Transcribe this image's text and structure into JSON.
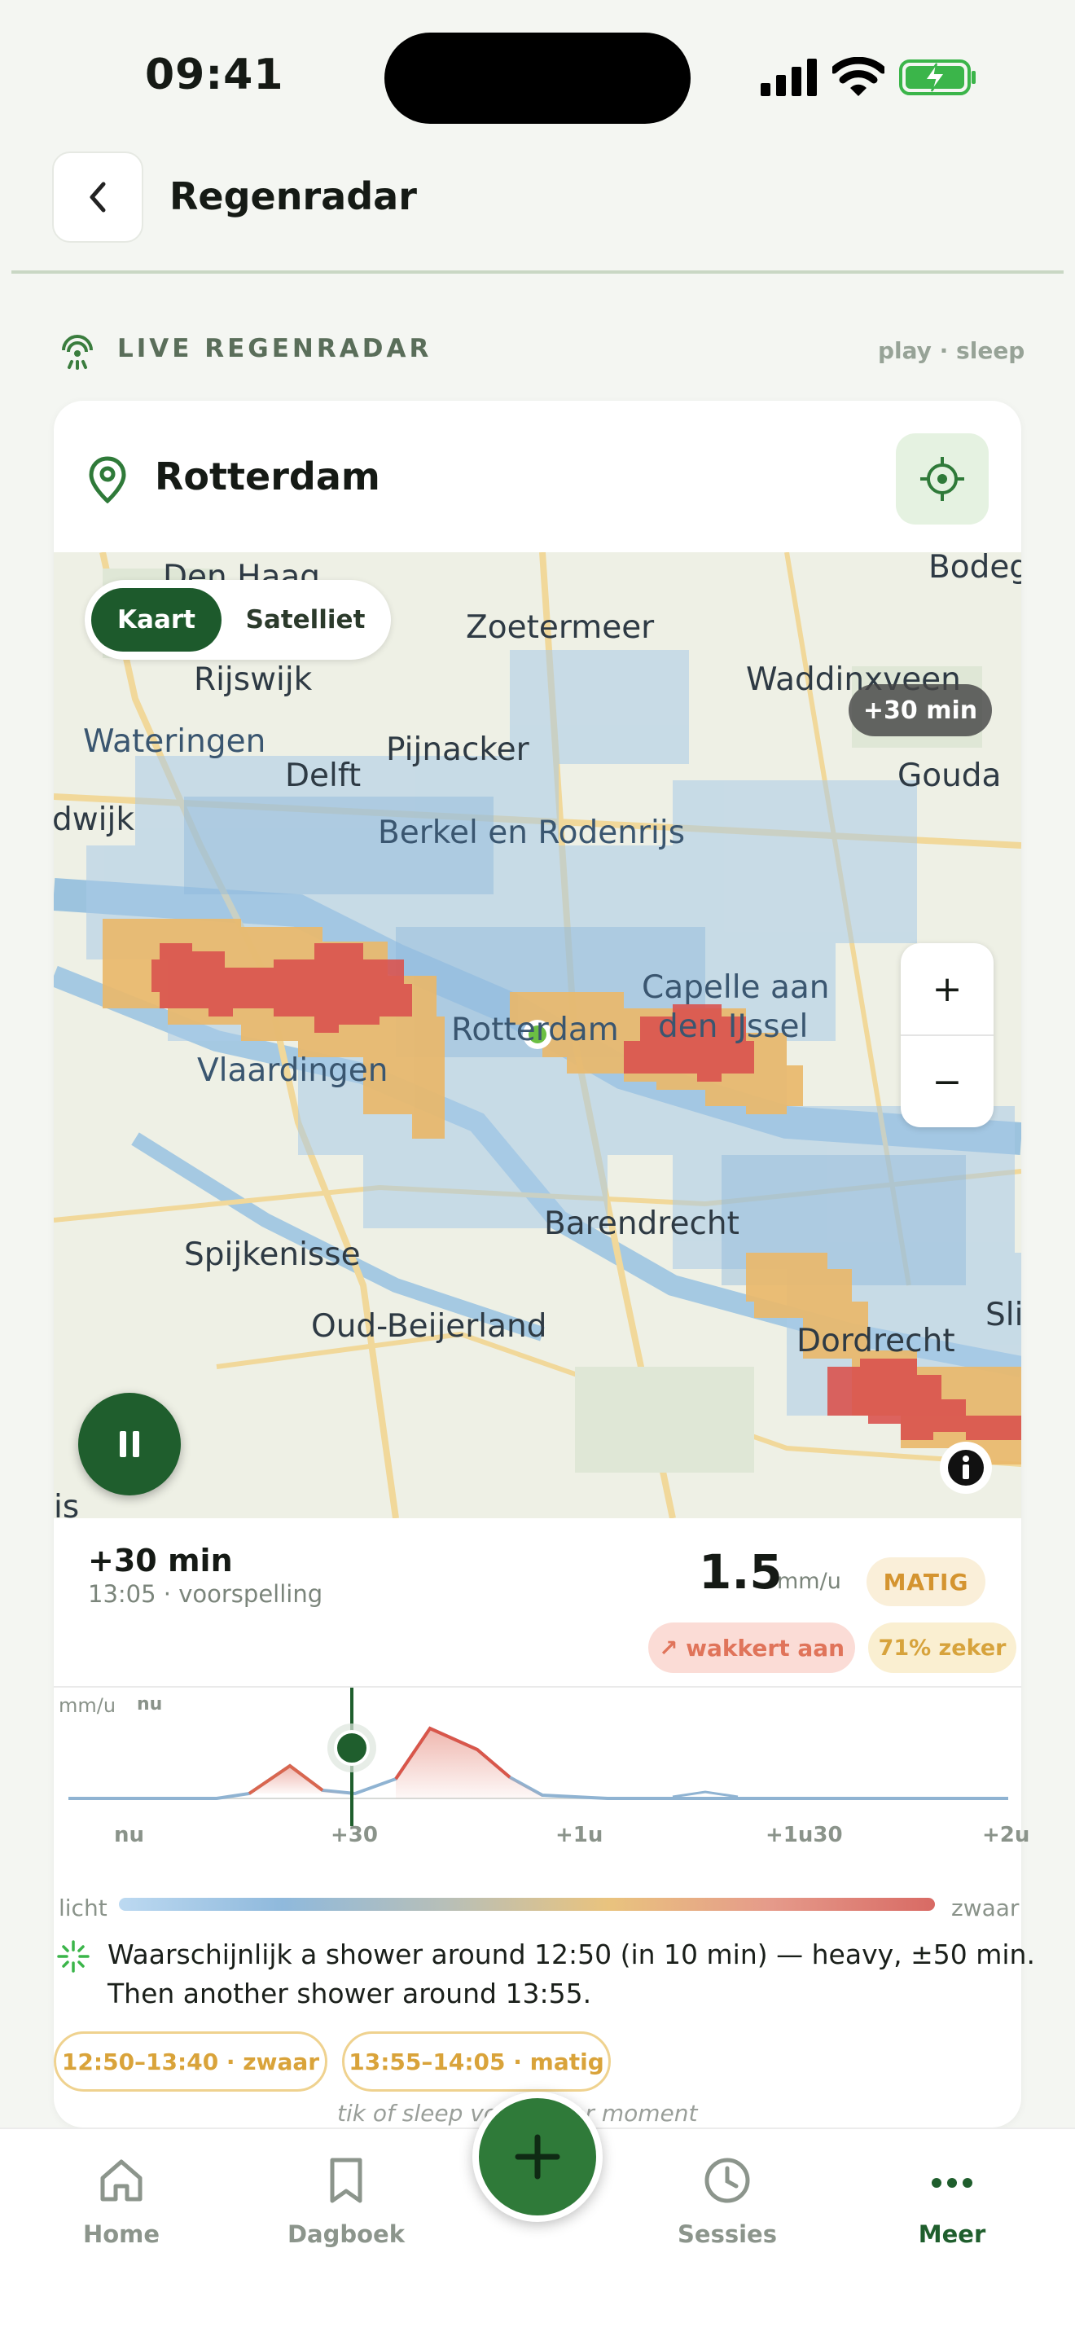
{
  "status": {
    "time": "09:41"
  },
  "header": {
    "title": "Regenradar"
  },
  "section": {
    "label": "LIVE REGENRADAR",
    "mode_hint": "play · sleep"
  },
  "location": {
    "city": "Rotterdam"
  },
  "map": {
    "view_toggle": {
      "active": "Kaart",
      "inactive": "Satelliet"
    },
    "time_offset": "+30 min",
    "zoom_in": "+",
    "zoom_out": "−",
    "labels": [
      "Den Haag",
      "Zoetermeer",
      "Bodeg",
      "Rijswijk",
      "Waddinxveen",
      "Wateringen",
      "Pijnacker",
      "Delft",
      "Gouda",
      "dwijk",
      "Berkel en Rodenrijs",
      "Capelle aan",
      "den IJssel",
      "Rotterdam",
      "Vlaardingen",
      "Barendrecht",
      "Spijkenisse",
      "Oud-Beijerland",
      "Dordrecht",
      "Sli",
      "is"
    ],
    "colors": {
      "light": "#a9cbe8",
      "moderate": "#e9b86b",
      "heavy": "#d9534f"
    }
  },
  "forecast": {
    "time": "+30 min",
    "sub": "13:05 · voorspelling",
    "value": "1.5",
    "unit": "mm/u",
    "intensity": "MATIG",
    "trend": "↗ wakkert aan",
    "confidence": "71% zeker"
  },
  "timeline": {
    "unit": "mm/u",
    "now_marker": "nu",
    "ticks": [
      "nu",
      "+30",
      "+1u",
      "+1u30",
      "+2u"
    ]
  },
  "legend": {
    "low": "licht",
    "high": "zwaar"
  },
  "summary": {
    "line1": "Waarschijnlijk a shower around 12:50 (in 10 min) — heavy, ±50 min.",
    "line2": "Then another shower around 13:55."
  },
  "chips": [
    "12:50–13:40 · zwaar",
    "13:55–14:05 · matig"
  ],
  "hint": "tik of sleep voor ander moment",
  "tabs": [
    {
      "label": "Home",
      "icon": "home-icon"
    },
    {
      "label": "Dagboek",
      "icon": "bookmark-icon"
    },
    {
      "label": "Sessies",
      "icon": "clock-icon"
    },
    {
      "label": "Meer",
      "icon": "more-icon"
    }
  ],
  "accent": "#1f5e2d"
}
